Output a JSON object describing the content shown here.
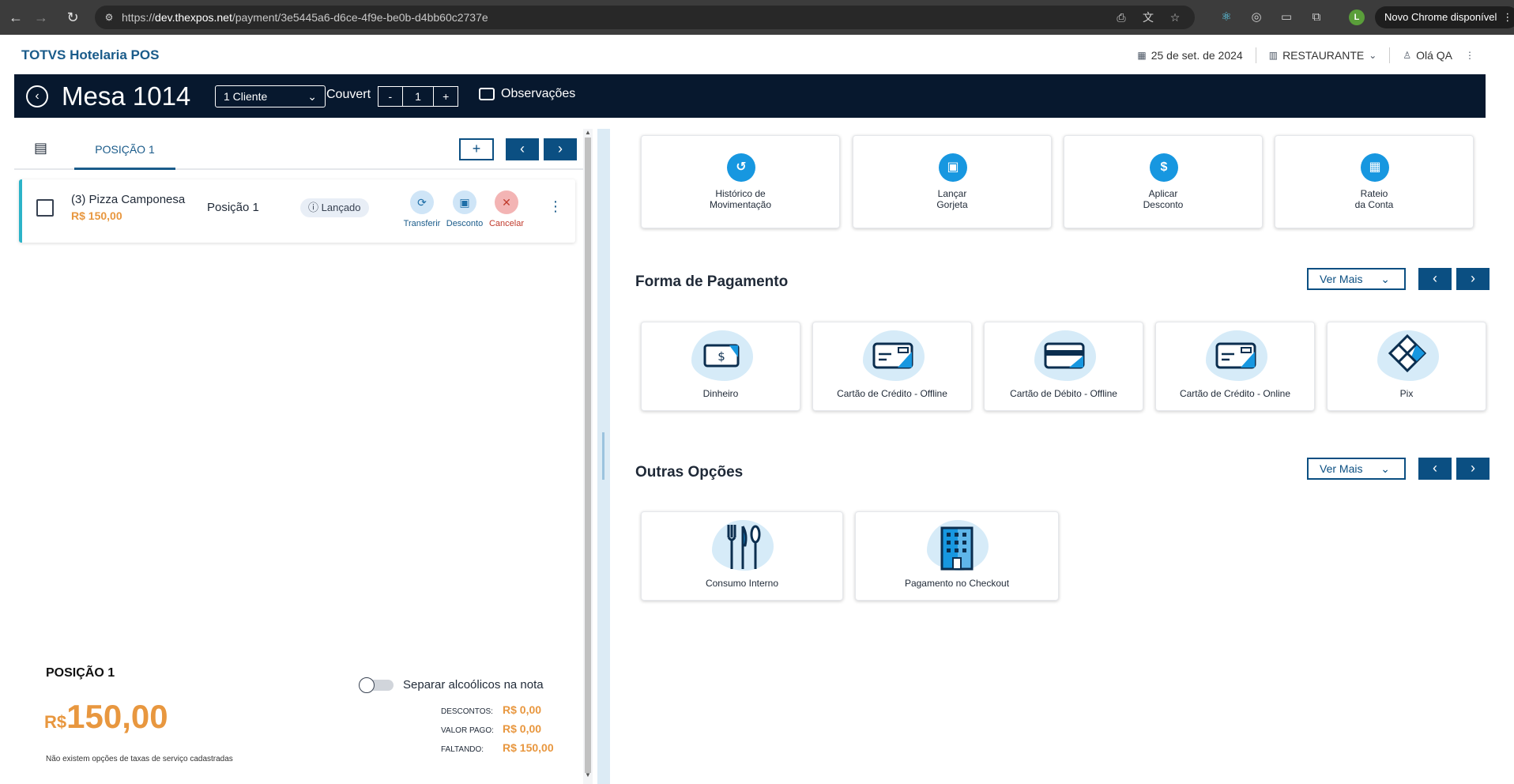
{
  "browser": {
    "url_prefix": "https://",
    "url_host": "dev.thexpos.net",
    "url_path": "/payment/3e5445a6-d6ce-4f9e-be0b-d4bb60c2737e",
    "profile_initial": "L",
    "new_chrome_label": "Novo Chrome disponível"
  },
  "header": {
    "brand": "TOTVS Hotelaria POS",
    "date": "25 de set. de 2024",
    "outlet": "RESTAURANTE",
    "greeting": "Olá QA"
  },
  "mesa_bar": {
    "title": "Mesa 1014",
    "client_select": "1 Cliente",
    "couvert_label": "Couvert",
    "couvert_minus": "-",
    "couvert_value": "1",
    "couvert_plus": "+",
    "observacoes": "Observações"
  },
  "left": {
    "tab_label": "POSIÇÃO 1",
    "add_label": "+",
    "item": {
      "name": "(3)  Pizza Camponesa",
      "price": "R$ 150,00",
      "position": "Posição 1",
      "status": "Lançado",
      "actions": {
        "transfer": "Transferir",
        "discount": "Desconto",
        "cancel": "Cancelar"
      }
    },
    "summary": {
      "title": "POSIÇÃO 1",
      "toggle_label": "Separar alcoólicos na nota",
      "currency": "R$",
      "total": "150,00",
      "no_taxes": "Não existem opções de taxas de serviço cadastradas",
      "rows": [
        {
          "label": "DESCONTOS:",
          "value": "R$ 0,00"
        },
        {
          "label": "VALOR PAGO:",
          "value": "R$ 0,00"
        },
        {
          "label": "FALTANDO:",
          "value": "R$ 150,00"
        }
      ]
    }
  },
  "right": {
    "actions": [
      {
        "line1": "Histórico de",
        "line2": "Movimentação",
        "icon": "history-icon"
      },
      {
        "line1": "Lançar",
        "line2": "Gorjeta",
        "icon": "wallet-icon"
      },
      {
        "line1": "Aplicar",
        "line2": "Desconto",
        "icon": "dollar-icon"
      },
      {
        "line1": "Rateio",
        "line2": "da Conta",
        "icon": "calculator-icon"
      }
    ],
    "payment_title": "Forma de Pagamento",
    "ver_mais": "Ver Mais",
    "payments": [
      {
        "label": "Dinheiro",
        "icon": "cash-icon"
      },
      {
        "label": "Cartão de Crédito - Offline",
        "icon": "credit-card-icon"
      },
      {
        "label": "Cartão de Débito - Offline",
        "icon": "debit-card-icon"
      },
      {
        "label": "Cartão de Crédito - Online",
        "icon": "credit-card-online-icon"
      },
      {
        "label": "Pix",
        "icon": "pix-icon"
      }
    ],
    "other_title": "Outras Opções",
    "others": [
      {
        "label": "Consumo Interno",
        "icon": "cutlery-icon"
      },
      {
        "label": "Pagamento no Checkout",
        "icon": "hotel-building-icon"
      }
    ]
  },
  "colors": {
    "brand": "#1a5b8a",
    "dark_bar": "#07182e",
    "accent_blue": "#1797e0",
    "nav_blue": "#0b4f82",
    "price_orange": "#e8973f",
    "card_highlight": "#2bb3c8"
  }
}
